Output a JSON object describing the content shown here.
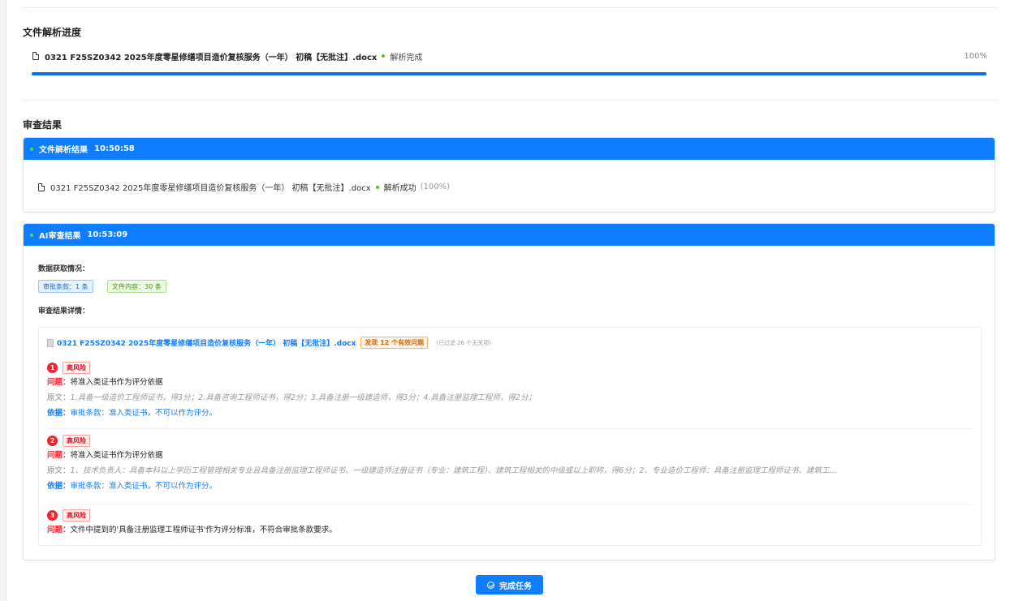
{
  "parse_progress": {
    "title": "文件解析进度",
    "file_name": "0321 F25SZ0342 2025年度零星修缮项目造价复核服务（一年） 初稿【无批注】.docx",
    "status": "解析完成",
    "percent_text": "100%",
    "progress": 1.0
  },
  "review_results": {
    "title": "审查结果",
    "parse_card": {
      "header": "文件解析结果",
      "time": "10:50:58",
      "file_name": "0321 F25SZ0342 2025年度零星修缮项目造价复核服务（一年） 初稿【无批注】.docx",
      "status": "解析成功",
      "percent": "(100%)"
    },
    "ai_card": {
      "header": "AI审查结果",
      "time": "10:53:09",
      "data_label": "数据获取情况：",
      "tag_approval": "审批条款：1 条",
      "tag_content": "文件内容：30 条",
      "detail_label": "审查结果详情：",
      "detail_file": "0321 F25SZ0342 2025年度零星修缮项目造价复核服务（一年） 初稿【无批注】.docx",
      "found": "发现 12 个有效问题",
      "filtered": "(已过滤 26 个无关项)",
      "issues": [
        {
          "num": "1",
          "risk": "高风险",
          "problem_label": "问题：",
          "problem": "将准入类证书作为评分依据",
          "orig_label": "原文：",
          "orig": "1.具备一级造价工程师证书，得3分；2.具备咨询工程师证书，得2分；3.具备注册一级建造师，得3分；4.具备注册监理工程师，得2分；",
          "basis_label": "依据：",
          "basis": "审批条款：准入类证书，不可以作为评分。"
        },
        {
          "num": "2",
          "risk": "高风险",
          "problem_label": "问题：",
          "problem": "将准入类证书作为评分依据",
          "orig_label": "原文：",
          "orig": "1、技术负责人：具备本科以上学历工程管理相关专业且具备注册监理工程师证书、一级建造师注册证书（专业：建筑工程）、建筑工程相关的中级或以上职称，得6分；2、专业造价工程师：具备注册监理工程师证书、建筑工...",
          "basis_label": "依据：",
          "basis": "审批条款：准入类证书，不可以作为评分。"
        },
        {
          "num": "3",
          "risk": "高风险",
          "problem_label": "问题：",
          "problem": "文件中提到的'具备注册监理工程师证书'作为评分标准，不符合审批条款要求。"
        }
      ]
    }
  },
  "complete_button": "完成任务",
  "colors": {
    "accent": "#0f7dff",
    "risk": "#f5222d",
    "success": "#52c41a"
  }
}
